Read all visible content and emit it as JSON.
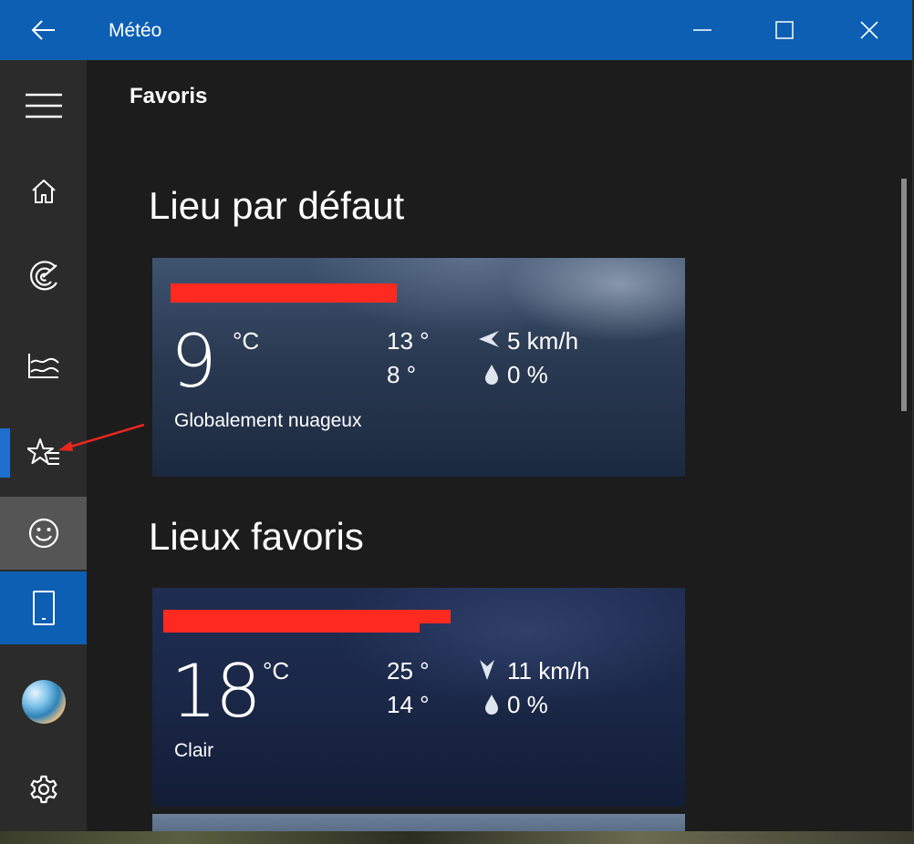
{
  "window": {
    "title": "Météo"
  },
  "page": {
    "title": "Favoris"
  },
  "sections": {
    "default_location": "Lieu par défaut",
    "favorite_locations": "Lieux favoris"
  },
  "cards": [
    {
      "temperature": "9",
      "unit": "°C",
      "high": "13 °",
      "low": "8 °",
      "wind": "5 km/h",
      "precipitation": "0 %",
      "condition": "Globalement nuageux",
      "wind_icon": "wind-direction-icon",
      "background": "cloudy"
    },
    {
      "temperature": "18",
      "unit": "°C",
      "high": "25 °",
      "low": "14 °",
      "wind": "11 km/h",
      "precipitation": "0 %",
      "condition": "Clair",
      "wind_icon": "wind-direction-icon",
      "background": "clear-night"
    }
  ],
  "sidebar": {
    "items": [
      {
        "icon": "hamburger-menu-icon"
      },
      {
        "icon": "home-icon"
      },
      {
        "icon": "radar-icon"
      },
      {
        "icon": "historical-weather-icon"
      },
      {
        "icon": "favorites-icon",
        "selected": true
      },
      {
        "icon": "feedback-smiley-icon"
      },
      {
        "icon": "phone-icon"
      },
      {
        "icon": "avatar"
      },
      {
        "icon": "settings-gear-icon"
      }
    ]
  },
  "colors": {
    "titlebar": "#0c5fb3",
    "accent": "#1f6fcf",
    "redaction": "#ff2a1f",
    "annotation_arrow": "#e8261c"
  }
}
